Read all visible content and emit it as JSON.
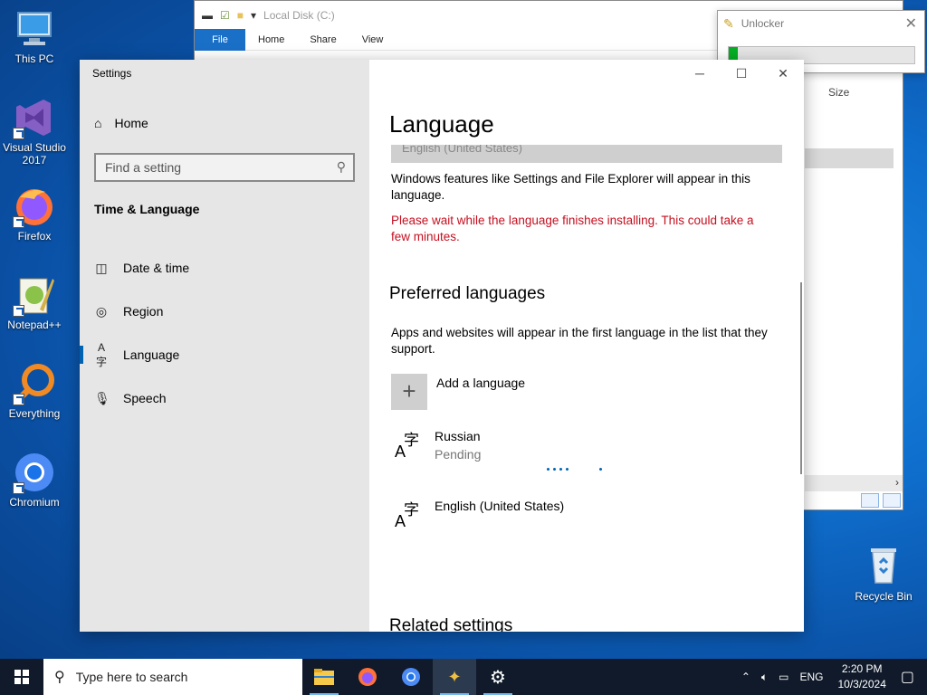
{
  "desktop": {
    "icons": [
      {
        "label": "This PC"
      },
      {
        "label": "Visual Studio 2017"
      },
      {
        "label": "Firefox"
      },
      {
        "label": "Notepad++"
      },
      {
        "label": "Everything"
      },
      {
        "label": "Chromium"
      }
    ],
    "recycle_bin": "Recycle Bin"
  },
  "explorer": {
    "title": "Local Disk (C:)",
    "tabs": [
      "File",
      "Home",
      "Share",
      "View"
    ],
    "size_column": "Size"
  },
  "unlocker": {
    "title": "Unlocker",
    "progress": 0.05,
    "progress_color": "#06b025"
  },
  "settings": {
    "window_title": "Settings",
    "nav": {
      "home": "Home",
      "search_placeholder": "Find a setting",
      "section": "Time & Language",
      "items": [
        {
          "label": "Date & time",
          "icon": "calendar-clock-icon"
        },
        {
          "label": "Region",
          "icon": "globe-icon"
        },
        {
          "label": "Language",
          "icon": "language-icon"
        },
        {
          "label": "Speech",
          "icon": "microphone-icon"
        }
      ]
    },
    "content": {
      "title": "Language",
      "dropdown_value": "English (United States)",
      "features_text": "Windows features like Settings and File Explorer will appear in this language.",
      "warning_text": "Please wait while the language finishes installing. This could take a few minutes.",
      "preferred_heading": "Preferred languages",
      "preferred_text": "Apps and websites will appear in the first language in the list that they support.",
      "add_language": "Add a language",
      "languages": [
        {
          "name": "Russian",
          "status": "Pending"
        },
        {
          "name": "English (United States)",
          "status": ""
        }
      ],
      "related_heading": "Related settings"
    }
  },
  "taskbar": {
    "search_placeholder": "Type here to search",
    "tray": {
      "lang": "ENG",
      "time": "2:20 PM",
      "date": "10/3/2024"
    }
  },
  "colors": {
    "accent": "#0063b1",
    "warning": "#c50f1f"
  }
}
